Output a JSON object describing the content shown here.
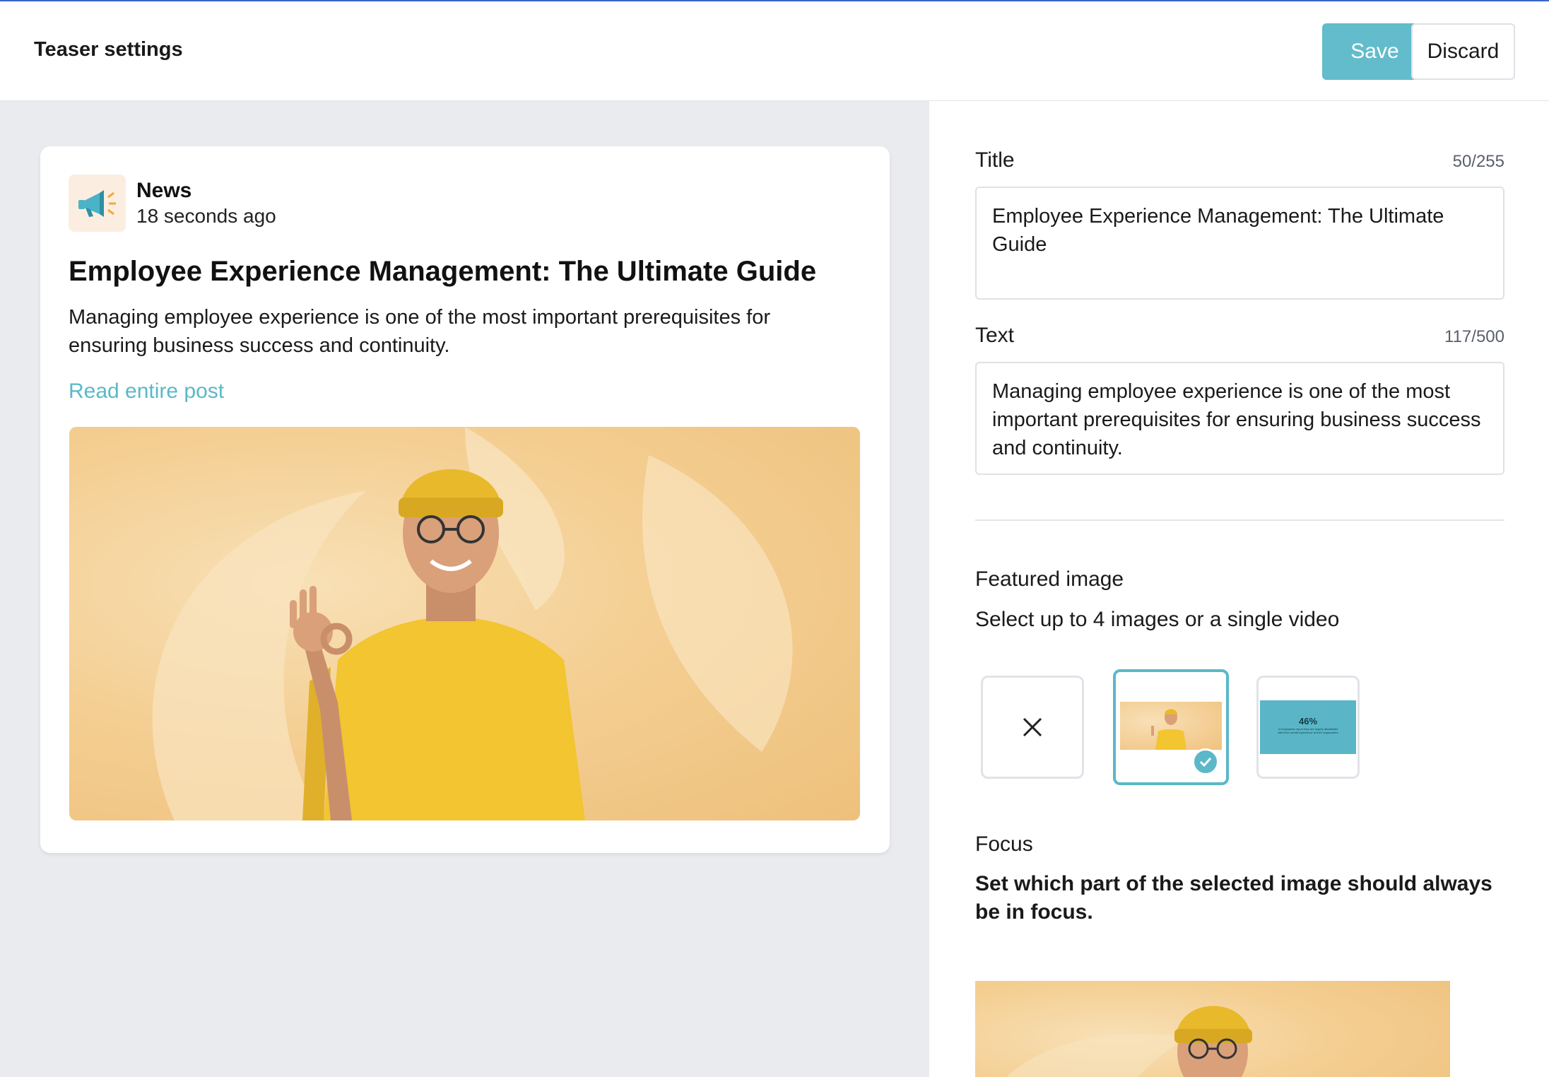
{
  "header": {
    "title": "Teaser settings",
    "save_label": "Save",
    "discard_label": "Discard"
  },
  "preview": {
    "source": "News",
    "time": "18 seconds ago",
    "title": "Employee Experience Management: The Ultimate Guide",
    "text": "Managing employee experience is one of the most important prerequisites for ensuring business success and continuity.",
    "link": "Read entire post",
    "avatar_icon": "megaphone-icon"
  },
  "form": {
    "title_label": "Title",
    "title_counter": "50/255",
    "title_value": "Employee Experience Management: The Ultimate Guide",
    "text_label": "Text",
    "text_counter": "117/500",
    "text_value": "Managing employee experience is one of the most important prerequisites for ensuring business success and continuity.",
    "featured_label": "Featured image",
    "featured_hint": "Select up to 4 images or a single video",
    "focus_label": "Focus",
    "focus_hint": "Set which part of the selected image should always be in focus."
  },
  "thumbnails": {
    "stat_value": "46%",
    "stat_caption": "of employees report they are largely dissatisfied with their overall experience at their organization"
  },
  "colors": {
    "accent": "#62bccc",
    "link": "#5bb8c8",
    "pane_bg": "#e9ebef",
    "shirt": "#f2c531"
  }
}
